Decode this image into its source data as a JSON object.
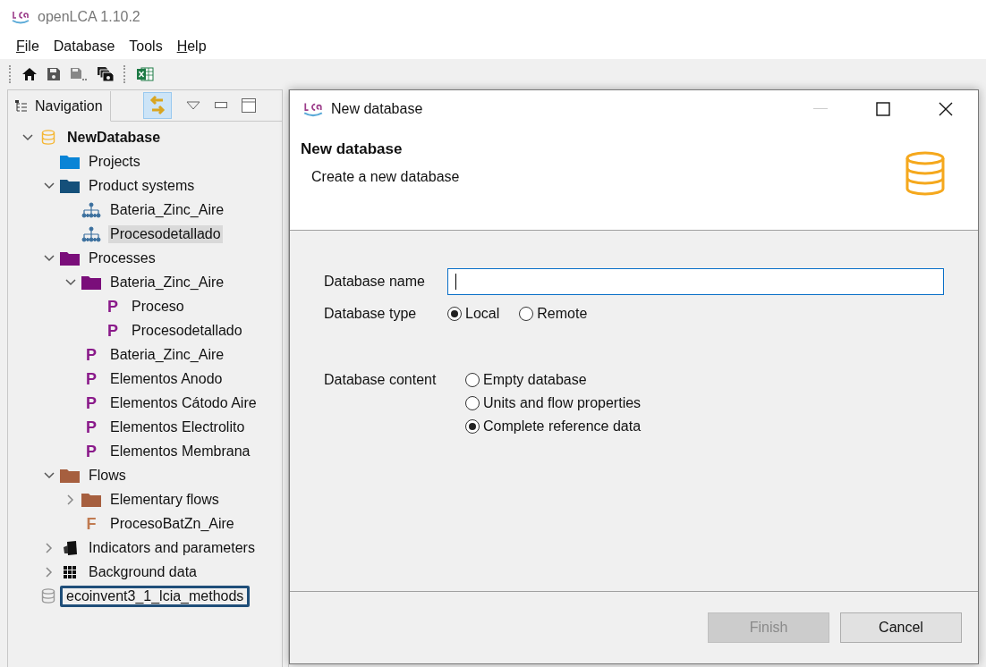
{
  "window": {
    "title": "openLCA 1.10.2"
  },
  "menu": [
    {
      "label": "File",
      "underlined_first": true
    },
    {
      "label": "Database",
      "underlined_first": false
    },
    {
      "label": "Tools",
      "underlined_first": false
    },
    {
      "label": "Help",
      "underlined_first": true
    }
  ],
  "navigation": {
    "tab": {
      "label": "Navigation",
      "selected": true
    },
    "tree": [
      {
        "label": "NewDatabase",
        "kind": "database",
        "active": true,
        "expanded": true,
        "selected": false,
        "highlighted": false,
        "children": [
          {
            "label": "Projects",
            "kind": "folder",
            "color": "#0a84d6",
            "selected": false,
            "highlighted": false
          },
          {
            "label": "Product systems",
            "kind": "folder",
            "color": "#15507a",
            "expanded": true,
            "selected": false,
            "highlighted": false,
            "children": [
              {
                "label": "Bateria_Zinc_Aire",
                "kind": "product-system",
                "selected": false,
                "highlighted": false
              },
              {
                "label": "Procesodetallado",
                "kind": "product-system",
                "selected": true,
                "highlighted": false
              }
            ]
          },
          {
            "label": "Processes",
            "kind": "folder",
            "color": "#7a0e7a",
            "expanded": true,
            "selected": false,
            "highlighted": false,
            "children": [
              {
                "label": "Bateria_Zinc_Aire",
                "kind": "folder",
                "color": "#7a0e7a",
                "expanded": true,
                "selected": false,
                "highlighted": false,
                "children": [
                  {
                    "label": "Proceso",
                    "kind": "process",
                    "glyph": "P",
                    "selected": false,
                    "highlighted": false
                  },
                  {
                    "label": "Procesodetallado",
                    "kind": "process",
                    "glyph": "P",
                    "selected": false,
                    "highlighted": false
                  }
                ]
              },
              {
                "label": "Bateria_Zinc_Aire",
                "kind": "process",
                "glyph": "P",
                "selected": false,
                "highlighted": false
              },
              {
                "label": "Elementos Anodo",
                "kind": "process",
                "glyph": "P",
                "selected": false,
                "highlighted": false
              },
              {
                "label": "Elementos Cátodo Aire",
                "kind": "process",
                "glyph": "P",
                "selected": false,
                "highlighted": false
              },
              {
                "label": "Elementos Electrolito",
                "kind": "process",
                "glyph": "P",
                "selected": false,
                "highlighted": false
              },
              {
                "label": "Elementos Membrana",
                "kind": "process",
                "glyph": "P",
                "selected": false,
                "highlighted": false
              }
            ]
          },
          {
            "label": "Flows",
            "kind": "folder",
            "color": "#a65f3f",
            "expanded": true,
            "selected": false,
            "highlighted": false,
            "children": [
              {
                "label": "Elementary flows",
                "kind": "folder",
                "color": "#a65f3f",
                "expanded": false,
                "selected": false,
                "highlighted": false
              },
              {
                "label": "ProcesoBatZn_Aire",
                "kind": "flow",
                "glyph": "F",
                "selected": false,
                "highlighted": false
              }
            ]
          },
          {
            "label": "Indicators and parameters",
            "kind": "indicators",
            "expanded": false,
            "selected": false,
            "highlighted": false
          },
          {
            "label": "Background data",
            "kind": "background",
            "expanded": false,
            "selected": false,
            "highlighted": false
          }
        ]
      },
      {
        "label": "ecoinvent3_1_lcia_methods",
        "kind": "database",
        "active": false,
        "selected": false,
        "highlighted": true
      }
    ]
  },
  "dialog": {
    "title": "New database",
    "heading": "New database",
    "description": "Create a new database",
    "name_field": {
      "label": "Database name",
      "focused": true
    },
    "type": {
      "label": "Database type",
      "options": [
        {
          "label": "Local",
          "selected": true
        },
        {
          "label": "Remote",
          "selected": false
        }
      ]
    },
    "content": {
      "label": "Database content",
      "options": [
        {
          "label": "Empty database",
          "selected": false
        },
        {
          "label": "Units and flow properties",
          "selected": false
        },
        {
          "label": "Complete reference data",
          "selected": true
        }
      ]
    },
    "buttons": [
      {
        "label": "Finish",
        "disabled": true
      },
      {
        "label": "Cancel",
        "disabled": false
      }
    ]
  }
}
